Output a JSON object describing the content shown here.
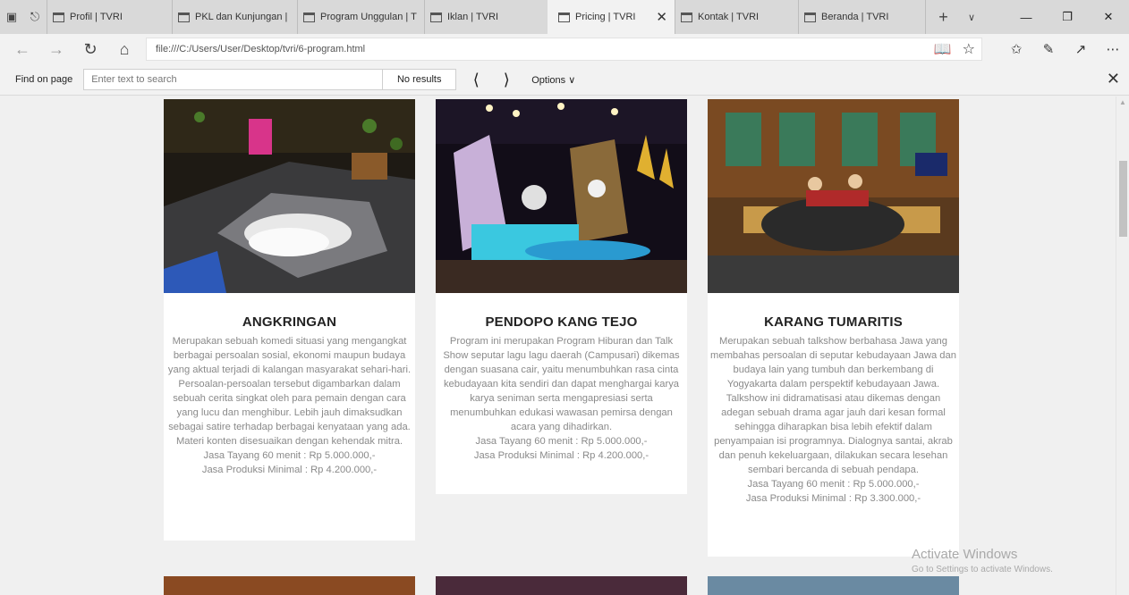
{
  "tabs": [
    {
      "label": "Profil | TVRI",
      "active": false
    },
    {
      "label": "PKL dan Kunjungan | TV",
      "active": false
    },
    {
      "label": "Program Unggulan | TV",
      "active": false
    },
    {
      "label": "Iklan | TVRI",
      "active": false
    },
    {
      "label": "Pricing | TVRI",
      "active": true
    },
    {
      "label": "Kontak | TVRI",
      "active": false
    },
    {
      "label": "Beranda | TVRI",
      "active": false
    }
  ],
  "address": {
    "url": "file:///C:/Users/User/Desktop/tvri/6-program.html"
  },
  "find": {
    "label": "Find on page",
    "placeholder": "Enter text to search",
    "results": "No results",
    "options": "Options"
  },
  "programs": [
    {
      "title": "ANGKRINGAN",
      "description": "Merupakan sebuah komedi situasi yang mengangkat berbagai persoalan sosial, ekonomi maupun budaya yang aktual terjadi di kalangan masyarakat sehari-hari. Persoalan-persoalan tersebut digambarkan dalam sebuah cerita singkat oleh para pemain dengan cara yang lucu dan menghibur. Lebih jauh dimaksudkan sebagai satire terhadap berbagai kenyataan yang ada. Materi konten disesuaikan dengan kehendak mitra.",
      "price_airtime": "Jasa Tayang 60 menit : Rp 5.000.000,-",
      "price_production": "Jasa Produksi Minimal : Rp 4.200.000,-"
    },
    {
      "title": "PENDOPO KANG TEJO",
      "description": "Program ini merupakan Program Hiburan dan Talk Show seputar lagu lagu daerah (Campusari) dikemas dengan suasana cair, yaitu menumbuhkan rasa cinta kebudayaan kita sendiri dan dapat menghargai karya karya seniman serta mengapresiasi serta menumbuhkan edukasi wawasan pemirsa dengan acara yang dihadirkan.",
      "price_airtime": "Jasa Tayang 60 menit : Rp 5.000.000,-",
      "price_production": "Jasa Produksi Minimal : Rp 4.200.000,-"
    },
    {
      "title": "KARANG TUMARITIS",
      "description": "Merupakan sebuah talkshow berbahasa Jawa yang membahas persoalan di seputar kebudayaan Jawa dan budaya lain yang tumbuh dan berkembang di Yogyakarta dalam perspektif kebudayaan Jawa. Talkshow ini didramatisasi atau dikemas dengan adegan sebuah drama agar jauh dari kesan formal sehingga diharapkan bisa lebih efektif dalam penyampaian isi programnya. Dialognya santai, akrab dan penuh kekeluargaan, dilakukan secara lesehan sembari bercanda di sebuah pendapa.",
      "price_airtime": "Jasa Tayang 60 menit : Rp 5.000.000,-",
      "price_production": "Jasa Produksi Minimal : Rp 3.300.000,-"
    }
  ],
  "watermark": {
    "title": "Activate Windows",
    "subtitle": "Go to Settings to activate Windows."
  }
}
